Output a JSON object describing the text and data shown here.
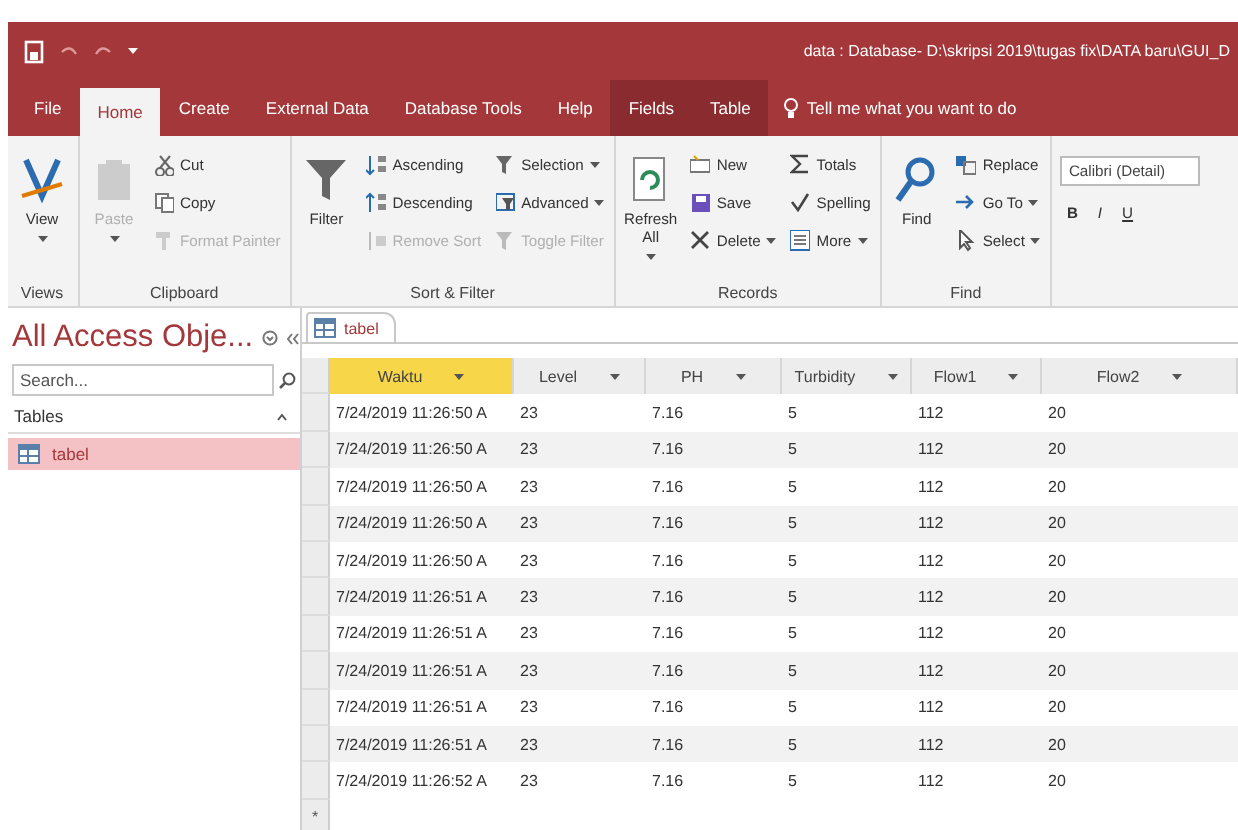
{
  "title_bar": {
    "title": "data : Database- D:\\skripsi 2019\\tugas fix\\DATA baru\\GUI_D"
  },
  "tabs": [
    {
      "label": "File",
      "selected": false,
      "kind": "normal"
    },
    {
      "label": "Home",
      "selected": true,
      "kind": "normal"
    },
    {
      "label": "Create",
      "selected": false,
      "kind": "normal"
    },
    {
      "label": "External Data",
      "selected": false,
      "kind": "normal"
    },
    {
      "label": "Database Tools",
      "selected": false,
      "kind": "normal"
    },
    {
      "label": "Help",
      "selected": false,
      "kind": "normal"
    },
    {
      "label": "Fields",
      "selected": false,
      "kind": "contextual"
    },
    {
      "label": "Table",
      "selected": false,
      "kind": "contextual"
    }
  ],
  "tell_me": {
    "placeholder": "Tell me what you want to do"
  },
  "ribbon": {
    "groups": [
      {
        "label": "Views",
        "large": [
          {
            "label": "View",
            "disabled": false,
            "dropdown": true
          }
        ]
      },
      {
        "label": "Clipboard",
        "large": [
          {
            "label": "Paste",
            "disabled": true,
            "dropdown": true
          }
        ],
        "columns": [
          [
            {
              "label": "Cut",
              "disabled": false,
              "dropdown": false
            },
            {
              "label": "Copy",
              "disabled": false,
              "dropdown": false
            },
            {
              "label": "Format Painter",
              "disabled": true,
              "dropdown": false
            }
          ]
        ]
      },
      {
        "label": "Sort & Filter",
        "large": [
          {
            "label": "Filter",
            "disabled": false,
            "dropdown": false
          }
        ],
        "columns": [
          [
            {
              "label": "Ascending",
              "disabled": false,
              "dropdown": false
            },
            {
              "label": "Descending",
              "disabled": false,
              "dropdown": false
            },
            {
              "label": "Remove Sort",
              "disabled": true,
              "dropdown": false
            }
          ],
          [
            {
              "label": "Selection",
              "disabled": false,
              "dropdown": true
            },
            {
              "label": "Advanced",
              "disabled": false,
              "dropdown": true
            },
            {
              "label": "Toggle Filter",
              "disabled": true,
              "dropdown": false
            }
          ]
        ]
      },
      {
        "label": "Records",
        "large": [
          {
            "label": "Refresh All",
            "disabled": false,
            "dropdown": true
          }
        ],
        "columns": [
          [
            {
              "label": "New",
              "disabled": false,
              "dropdown": false
            },
            {
              "label": "Save",
              "disabled": false,
              "dropdown": false
            },
            {
              "label": "Delete",
              "disabled": false,
              "dropdown": true
            }
          ],
          [
            {
              "label": "Totals",
              "disabled": false,
              "dropdown": false
            },
            {
              "label": "Spelling",
              "disabled": false,
              "dropdown": false
            },
            {
              "label": "More",
              "disabled": false,
              "dropdown": true
            }
          ]
        ]
      },
      {
        "label": "Find",
        "large": [
          {
            "label": "Find",
            "disabled": false,
            "dropdown": false
          }
        ],
        "columns": [
          [
            {
              "label": "Replace",
              "disabled": false,
              "dropdown": false
            },
            {
              "label": "Go To",
              "disabled": false,
              "dropdown": true
            },
            {
              "label": "Select",
              "disabled": false,
              "dropdown": true
            }
          ]
        ]
      }
    ],
    "font": {
      "value": "Calibri (Detail)",
      "styles": [
        "B",
        "I",
        "U"
      ]
    }
  },
  "nav": {
    "title": "All Access Obje...",
    "search": {
      "placeholder": "Search..."
    },
    "section": "Tables",
    "items": [
      {
        "label": "tabel",
        "selected": true
      }
    ]
  },
  "sheet": {
    "tab": "tabel",
    "columns": [
      {
        "label": "Waktu",
        "selected": true
      },
      {
        "label": "Level",
        "selected": false
      },
      {
        "label": "PH",
        "selected": false
      },
      {
        "label": "Turbidity",
        "selected": false
      },
      {
        "label": "Flow1",
        "selected": false
      },
      {
        "label": "Flow2",
        "selected": false
      }
    ],
    "rows": [
      [
        "7/24/2019 11:26:50 A",
        "23",
        "7.16",
        "5",
        "112",
        "20"
      ],
      [
        "7/24/2019 11:26:50 A",
        "23",
        "7.16",
        "5",
        "112",
        "20"
      ],
      [
        "7/24/2019 11:26:50 A",
        "23",
        "7.16",
        "5",
        "112",
        "20"
      ],
      [
        "7/24/2019 11:26:50 A",
        "23",
        "7.16",
        "5",
        "112",
        "20"
      ],
      [
        "7/24/2019 11:26:50 A",
        "23",
        "7.16",
        "5",
        "112",
        "20"
      ],
      [
        "7/24/2019 11:26:51 A",
        "23",
        "7.16",
        "5",
        "112",
        "20"
      ],
      [
        "7/24/2019 11:26:51 A",
        "23",
        "7.16",
        "5",
        "112",
        "20"
      ],
      [
        "7/24/2019 11:26:51 A",
        "23",
        "7.16",
        "5",
        "112",
        "20"
      ],
      [
        "7/24/2019 11:26:51 A",
        "23",
        "7.16",
        "5",
        "112",
        "20"
      ],
      [
        "7/24/2019 11:26:51 A",
        "23",
        "7.16",
        "5",
        "112",
        "20"
      ],
      [
        "7/24/2019 11:26:52 A",
        "23",
        "7.16",
        "5",
        "112",
        "20"
      ]
    ],
    "new_row_marker": "*"
  }
}
